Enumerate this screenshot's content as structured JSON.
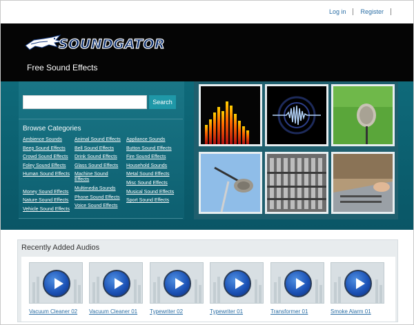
{
  "top_links": {
    "login": "Log in",
    "register": "Register"
  },
  "header": {
    "logo_text": "SOUNDGATOR",
    "tagline": "Free Sound Effects"
  },
  "search": {
    "placeholder": "",
    "button_label": "Search"
  },
  "browse": {
    "title": "Browse Categories",
    "columns": [
      [
        "Ambience Sounds",
        "Beep Sound Effects",
        "Crowd Sound Effects",
        "Foley Sound Effects",
        "Human Sound Effects",
        "",
        "Money Sound Effects",
        "Nature Sound Effects",
        "Vehicle Sound Effects"
      ],
      [
        "Animal Sound Effects",
        "Bell Sound Effects",
        "Drink Sound Effects",
        "Glass Sound Effects",
        "Machine Sound Effects",
        "Multimedia Sounds",
        "Phone Sound Effects",
        "Voice Sound Effects"
      ],
      [
        "Appliance Sounds",
        "Button Sound Effects",
        "Fire Sound Effects",
        "Household Sounds",
        "Metal Sound Effects",
        "Misc Sound Effects",
        "Musical Sound Effects",
        "Sport Sound Effects"
      ]
    ]
  },
  "tiles": [
    "equalizer-image",
    "waveform-image",
    "field-microphone-image",
    "boom-microphone-image",
    "studio-mixer-image",
    "mixing-desk-image"
  ],
  "recent": {
    "title": "Recently Added Audios",
    "items": [
      "Vacuum Cleaner 02",
      "Vacuum Cleaner 01",
      "Typewriter 02",
      "Typewriter 01",
      "Transformer 01",
      "Smoke Alarm 01"
    ]
  },
  "colors": {
    "accent": "#1f98a8",
    "band": "#0f6a7a",
    "link": "#2a6ea5",
    "header": "#050505"
  }
}
